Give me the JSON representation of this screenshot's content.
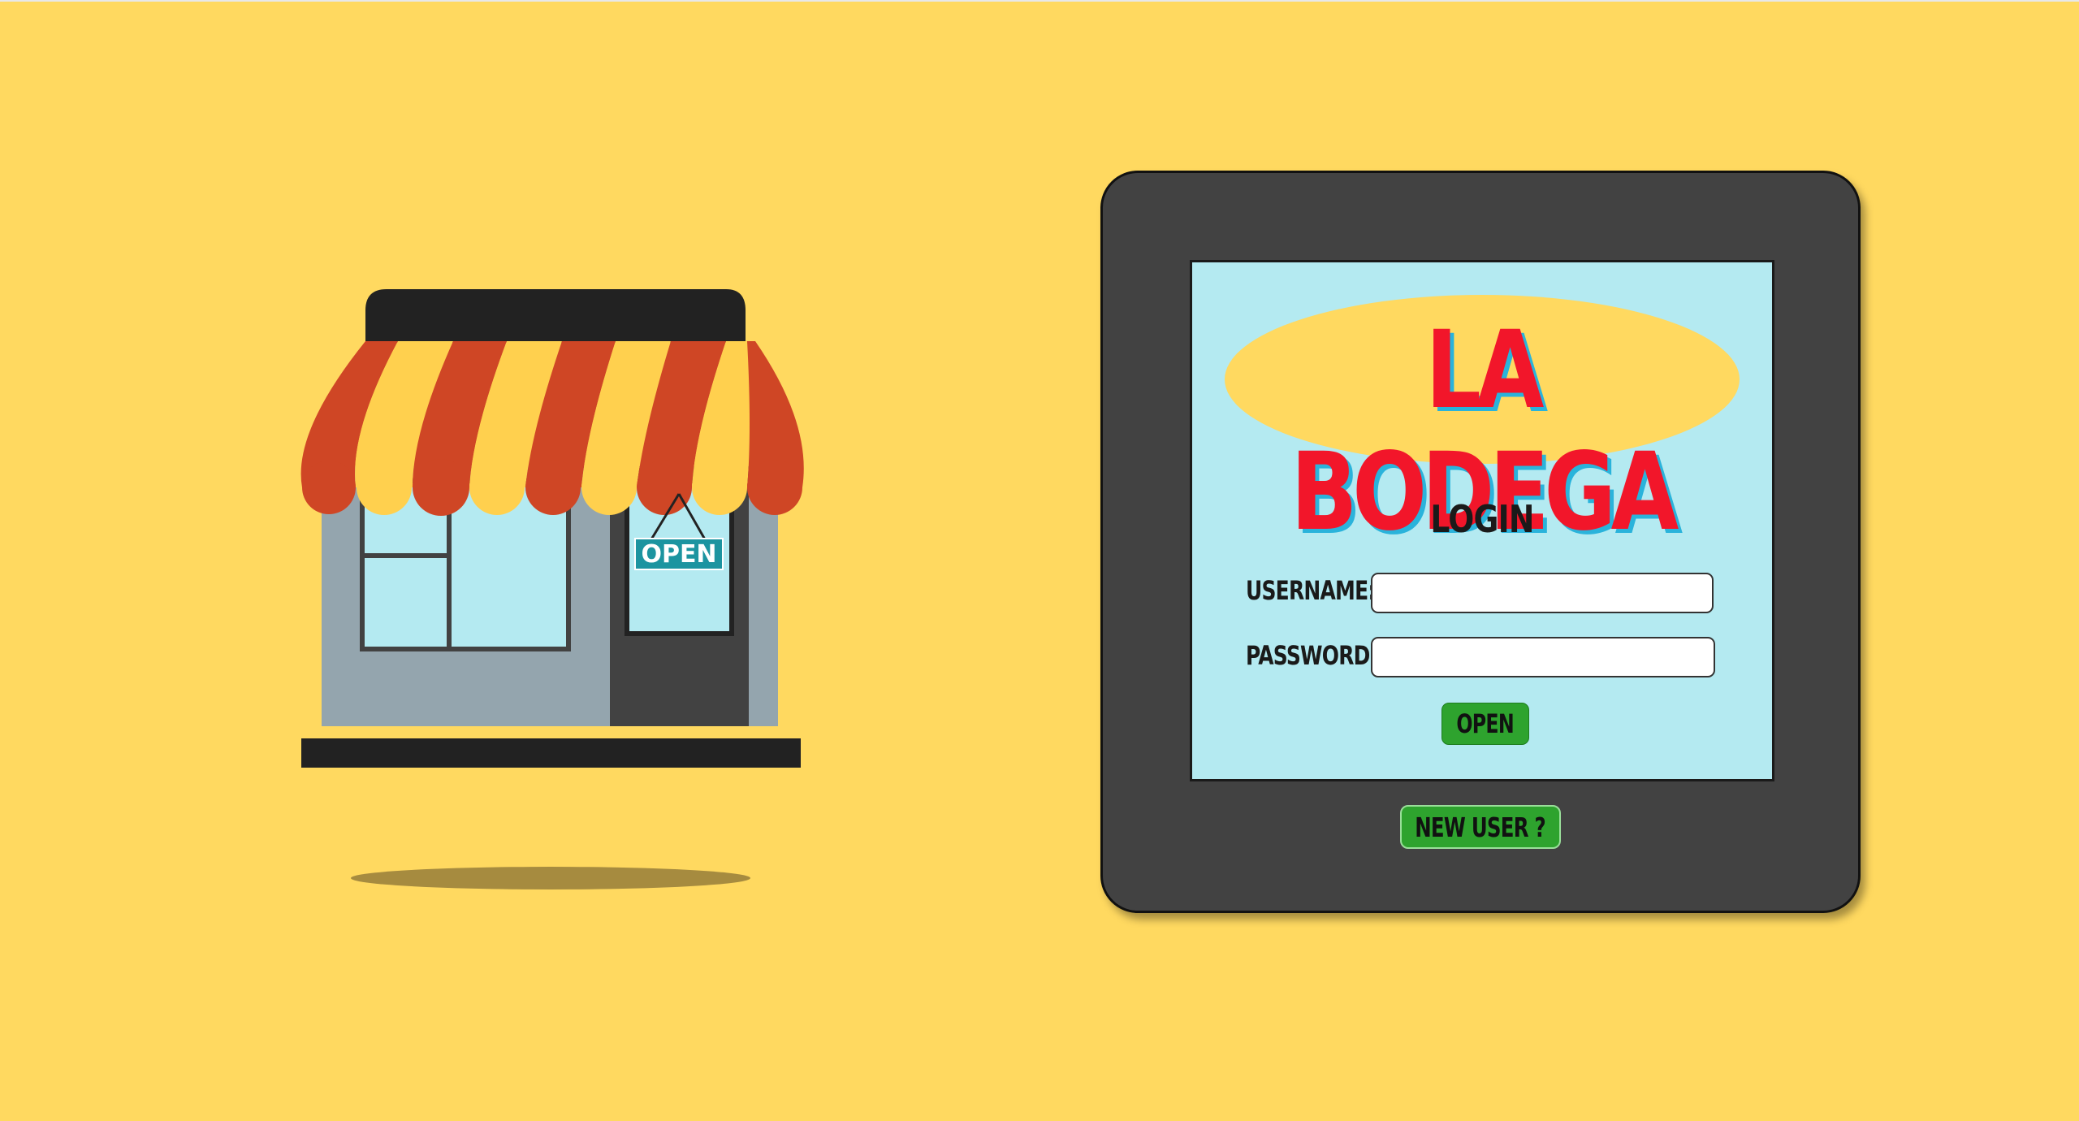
{
  "colors": {
    "background": "#FFD960",
    "tablet_frame": "#424242",
    "screen": "#B4EAF1",
    "logo_red": "#F2162A",
    "logo_shadow": "#2AB3DB",
    "button_green": "#2EA32E",
    "awning_red": "#CF4625",
    "awning_yellow": "#FFD04E"
  },
  "illustration": {
    "sign_text": "OPEN",
    "icon": "storefront-icon"
  },
  "logo": {
    "text": "LA BODEGA"
  },
  "login": {
    "title": "LOGIN",
    "username_label": "USERNAME:",
    "username_value": "",
    "password_label": "PASSWORD:",
    "password_value": "",
    "submit_label": "OPEN",
    "new_user_label": "NEW USER ?"
  }
}
